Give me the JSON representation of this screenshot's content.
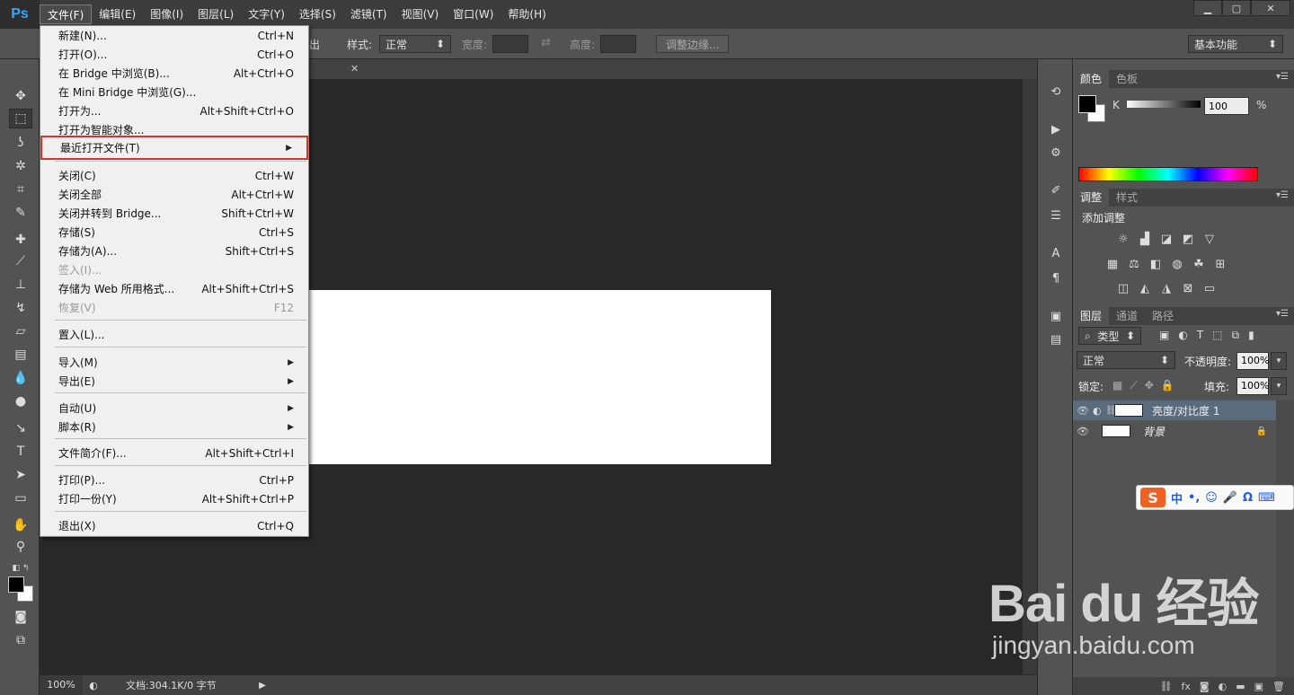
{
  "app": {
    "logo": "Ps"
  },
  "menubar": [
    "文件(F)",
    "编辑(E)",
    "图像(I)",
    "图层(L)",
    "文字(Y)",
    "选择(S)",
    "滤镜(T)",
    "视图(V)",
    "窗口(W)",
    "帮助(H)"
  ],
  "window": {
    "min": "▁",
    "max": "▢",
    "close": "✕"
  },
  "options": {
    "frag": "出",
    "style_label": "样式:",
    "style_value": "正常",
    "width_label": "宽度:",
    "height_label": "高度:",
    "refine_btn": "调整边缘...",
    "workspace": "基本功能"
  },
  "file_menu": [
    {
      "label": "新建(N)...",
      "shortcut": "Ctrl+N"
    },
    {
      "label": "打开(O)...",
      "shortcut": "Ctrl+O"
    },
    {
      "label": "在 Bridge 中浏览(B)...",
      "shortcut": "Alt+Ctrl+O"
    },
    {
      "label": "在 Mini Bridge 中浏览(G)...",
      "shortcut": ""
    },
    {
      "label": "打开为...",
      "shortcut": "Alt+Shift+Ctrl+O"
    },
    {
      "label": "打开为智能对象...",
      "shortcut": ""
    },
    {
      "label": "最近打开文件(T)",
      "shortcut": ""
    },
    {
      "label": "关闭(C)",
      "shortcut": "Ctrl+W"
    },
    {
      "label": "关闭全部",
      "shortcut": "Alt+Ctrl+W"
    },
    {
      "label": "关闭并转到 Bridge...",
      "shortcut": "Shift+Ctrl+W"
    },
    {
      "label": "存储(S)",
      "shortcut": "Ctrl+S"
    },
    {
      "label": "存储为(A)...",
      "shortcut": "Shift+Ctrl+S"
    },
    {
      "label": "签入(I)...",
      "shortcut": ""
    },
    {
      "label": "存储为 Web 所用格式...",
      "shortcut": "Alt+Shift+Ctrl+S"
    },
    {
      "label": "恢复(V)",
      "shortcut": "F12"
    },
    {
      "label": "置入(L)...",
      "shortcut": ""
    },
    {
      "label": "导入(M)",
      "shortcut": ""
    },
    {
      "label": "导出(E)",
      "shortcut": ""
    },
    {
      "label": "自动(U)",
      "shortcut": ""
    },
    {
      "label": "脚本(R)",
      "shortcut": ""
    },
    {
      "label": "文件简介(F)...",
      "shortcut": "Alt+Shift+Ctrl+I"
    },
    {
      "label": "打印(P)...",
      "shortcut": "Ctrl+P"
    },
    {
      "label": "打印一份(Y)",
      "shortcut": "Alt+Shift+Ctrl+P"
    },
    {
      "label": "退出(X)",
      "shortcut": "Ctrl+Q"
    }
  ],
  "status": {
    "zoom": "100%",
    "doc_info": "文档:304.1K/0 字节"
  },
  "color_panel": {
    "tabs": [
      "颜色",
      "色板"
    ],
    "channel": "K",
    "value": "100",
    "unit": "%"
  },
  "adjust_panel": {
    "tabs": [
      "调整",
      "样式"
    ],
    "title": "添加调整"
  },
  "layers_panel": {
    "tabs": [
      "图层",
      "通道",
      "路径"
    ],
    "filter": "类型",
    "blend": "正常",
    "opacity_label": "不透明度:",
    "opacity": "100%",
    "lock_label": "锁定:",
    "fill_label": "填充:",
    "fill": "100%",
    "layers": [
      "亮度/对比度 1",
      "背景"
    ]
  },
  "ime": {
    "logo": "S",
    "mode": "中",
    "punct": "•,"
  },
  "watermark": {
    "brand": "Bai du 经验",
    "url": "jingyan.baidu.com"
  }
}
